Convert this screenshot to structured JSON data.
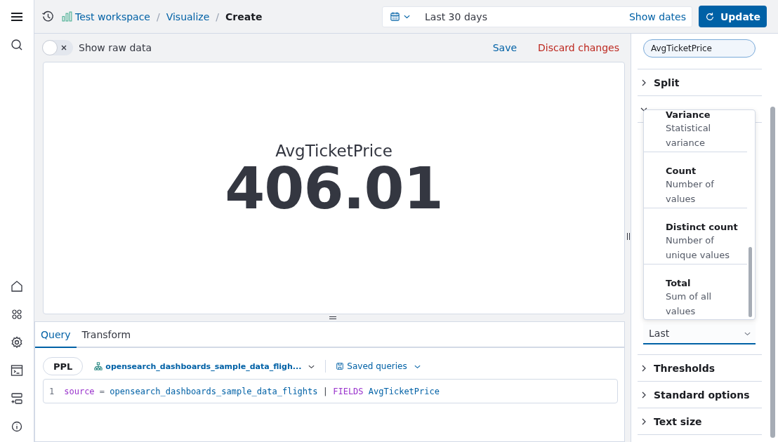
{
  "breadcrumbs": [
    {
      "label": "Test workspace",
      "kind": "workspace"
    },
    {
      "label": "Visualize",
      "kind": "link",
      "separator": "/"
    },
    {
      "label": "Create",
      "kind": "current",
      "separator": "/"
    }
  ],
  "date_picker": {
    "value": "Last 30 days",
    "link": "Show dates"
  },
  "update_button": "Update",
  "toolbar": {
    "raw_toggle": {
      "label": "Show raw data",
      "on": false
    },
    "save": "Save",
    "discard": "Discard changes"
  },
  "metric": {
    "title": "AvgTicketPrice",
    "value": "406.01"
  },
  "tabs": [
    {
      "label": "Query",
      "selected": true
    },
    {
      "label": "Transform",
      "selected": false
    }
  ],
  "query_bar": {
    "language": "PPL",
    "dataset": "opensearch_dashboards_sample_data_fligh...",
    "saved": "Saved queries"
  },
  "editor": {
    "lines": [
      {
        "number": "1",
        "tokens": [
          {
            "text": "source",
            "kind": "keyword"
          },
          {
            "text": "=",
            "kind": "operator"
          },
          {
            "text": "opensearch_dashboards_sample_data_flights",
            "kind": "identifier"
          },
          {
            "text": "|",
            "kind": "pipe"
          },
          {
            "text": "FIELDS",
            "kind": "keyword"
          },
          {
            "text": "AvgTicketPrice",
            "kind": "identifier"
          }
        ]
      }
    ]
  },
  "side_panel": {
    "field": "AvgTicketPrice",
    "sections_top": [
      {
        "label": "Split",
        "expanded": false
      },
      {
        "expanded": true
      }
    ],
    "popover": [
      {
        "title": "Variance",
        "description": "Statistical variance"
      },
      {
        "title": "Count",
        "description": "Number of values"
      },
      {
        "title": "Distinct count",
        "description": "Number of unique values"
      },
      {
        "title": "Total",
        "description": "Sum of all values"
      }
    ],
    "select": {
      "value": "Last"
    },
    "sections_bottom": [
      {
        "label": "Thresholds",
        "expanded": false
      },
      {
        "label": "Standard options",
        "expanded": false
      },
      {
        "label": "Text size",
        "expanded": false
      }
    ]
  }
}
